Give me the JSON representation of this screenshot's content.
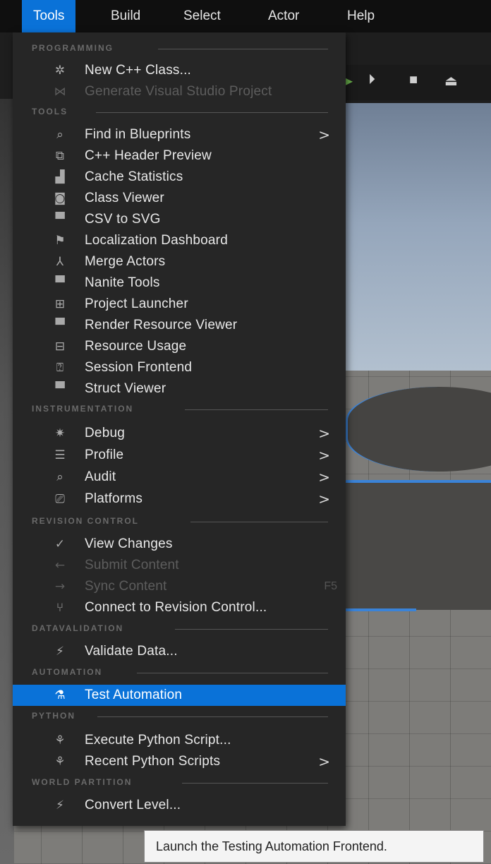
{
  "menubar": {
    "items": [
      {
        "label": "Tools",
        "active": true
      },
      {
        "label": "Build"
      },
      {
        "label": "Select"
      },
      {
        "label": "Actor"
      },
      {
        "label": "Help"
      }
    ]
  },
  "menu": {
    "sections": {
      "programming": "PROGRAMMING",
      "tools": "TOOLS",
      "instrumentation": "INSTRUMENTATION",
      "revision_control": "REVISION CONTROL",
      "datavalidation": "DATAVALIDATION",
      "automation": "AUTOMATION",
      "python": "PYTHON",
      "world_partition": "WORLD PARTITION"
    },
    "items": {
      "new_cpp_class": {
        "label": "New C++ Class...",
        "icon": "cpp-class-icon"
      },
      "generate_vs_project": {
        "label": "Generate Visual Studio Project",
        "icon": "visual-studio-icon",
        "disabled": true
      },
      "find_in_blueprints": {
        "label": "Find in Blueprints",
        "icon": "find-blueprints-icon",
        "submenu": true
      },
      "cpp_header_preview": {
        "label": "C++ Header Preview",
        "icon": "header-preview-icon"
      },
      "cache_statistics": {
        "label": "Cache Statistics",
        "icon": "bar-chart-icon"
      },
      "class_viewer": {
        "label": "Class Viewer",
        "icon": "class-viewer-icon"
      },
      "csv_to_svg": {
        "label": "CSV to SVG",
        "icon": "tab-window-icon"
      },
      "localization_dashboard": {
        "label": "Localization Dashboard",
        "icon": "flag-icon"
      },
      "merge_actors": {
        "label": "Merge Actors",
        "icon": "merge-icon"
      },
      "nanite_tools": {
        "label": "Nanite Tools",
        "icon": "tab-window-icon"
      },
      "project_launcher": {
        "label": "Project Launcher",
        "icon": "launcher-icon"
      },
      "render_resource_viewer": {
        "label": "Render Resource Viewer",
        "icon": "tab-window-icon"
      },
      "resource_usage": {
        "label": "Resource Usage",
        "icon": "table-icon"
      },
      "session_frontend": {
        "label": "Session Frontend",
        "icon": "session-icon"
      },
      "struct_viewer": {
        "label": "Struct Viewer",
        "icon": "tab-window-icon"
      },
      "debug": {
        "label": "Debug",
        "icon": "bug-icon",
        "submenu": true
      },
      "profile": {
        "label": "Profile",
        "icon": "profile-icon",
        "submenu": true
      },
      "audit": {
        "label": "Audit",
        "icon": "audit-icon",
        "submenu": true
      },
      "platforms": {
        "label": "Platforms",
        "icon": "platforms-icon",
        "submenu": true
      },
      "view_changes": {
        "label": "View Changes",
        "icon": "check-circle-icon"
      },
      "submit_content": {
        "label": "Submit Content",
        "icon": "arrow-left-icon",
        "disabled": true
      },
      "sync_content": {
        "label": "Sync Content",
        "icon": "arrow-right-icon",
        "disabled": true,
        "shortcut": "F5"
      },
      "connect_revision_control": {
        "label": "Connect to Revision Control...",
        "icon": "branch-icon"
      },
      "validate_data": {
        "label": "Validate Data...",
        "icon": "validate-icon"
      },
      "test_automation": {
        "label": "Test Automation",
        "icon": "test-flask-icon",
        "highlighted": true
      },
      "execute_python_script": {
        "label": "Execute Python Script...",
        "icon": "python-icon"
      },
      "recent_python_scripts": {
        "label": "Recent Python Scripts",
        "icon": "python-recent-icon",
        "submenu": true
      },
      "convert_level": {
        "label": "Convert Level...",
        "icon": "validate-icon"
      }
    },
    "submenu_arrow": ">"
  },
  "tooltip": {
    "text": "Launch the Testing Automation Frontend."
  },
  "colors": {
    "highlight": "#0a72d8",
    "menu_bg": "#262626",
    "menubar_bg": "#0f0f0f"
  }
}
